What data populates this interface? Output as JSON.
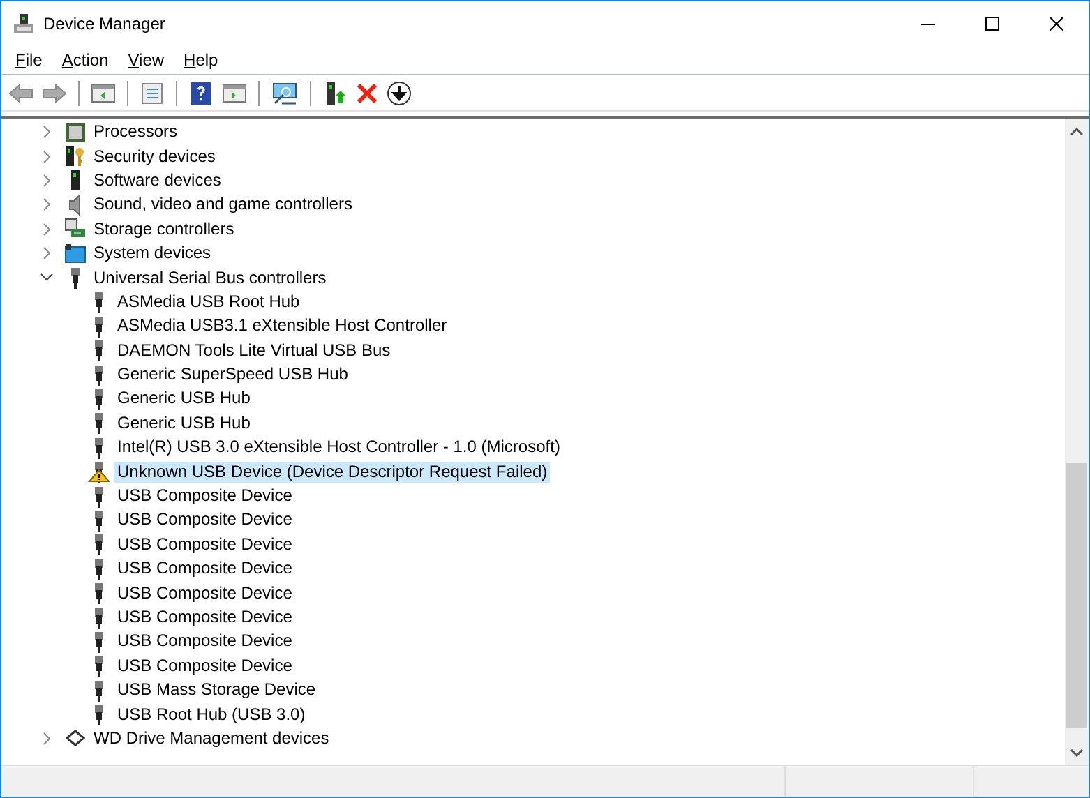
{
  "window": {
    "title": "Device Manager"
  },
  "menu": [
    "File",
    "Action",
    "View",
    "Help"
  ],
  "tree": [
    {
      "label": "Processors",
      "kind": "processor",
      "expanded": false,
      "selected": false
    },
    {
      "label": "Security devices",
      "kind": "security",
      "expanded": false,
      "selected": false
    },
    {
      "label": "Software devices",
      "kind": "software",
      "expanded": false,
      "selected": false
    },
    {
      "label": "Sound, video and game controllers",
      "kind": "sound",
      "expanded": false,
      "selected": false
    },
    {
      "label": "Storage controllers",
      "kind": "storage",
      "expanded": false,
      "selected": false
    },
    {
      "label": "System devices",
      "kind": "system",
      "expanded": false,
      "selected": false
    },
    {
      "label": "Universal Serial Bus controllers",
      "kind": "usb",
      "expanded": true,
      "selected": false,
      "children": [
        {
          "label": "ASMedia USB Root Hub",
          "kind": "usb",
          "selected": false
        },
        {
          "label": "ASMedia USB3.1 eXtensible Host Controller",
          "kind": "usb",
          "selected": false
        },
        {
          "label": "DAEMON Tools Lite Virtual USB Bus",
          "kind": "usb",
          "selected": false
        },
        {
          "label": "Generic SuperSpeed USB Hub",
          "kind": "usb",
          "selected": false
        },
        {
          "label": "Generic USB Hub",
          "kind": "usb",
          "selected": false
        },
        {
          "label": "Generic USB Hub",
          "kind": "usb",
          "selected": false
        },
        {
          "label": "Intel(R) USB 3.0 eXtensible Host Controller - 1.0 (Microsoft)",
          "kind": "usb",
          "selected": false
        },
        {
          "label": "Unknown USB Device (Device Descriptor Request Failed)",
          "kind": "warning",
          "selected": true
        },
        {
          "label": "USB Composite Device",
          "kind": "usb",
          "selected": false
        },
        {
          "label": "USB Composite Device",
          "kind": "usb",
          "selected": false
        },
        {
          "label": "USB Composite Device",
          "kind": "usb",
          "selected": false
        },
        {
          "label": "USB Composite Device",
          "kind": "usb",
          "selected": false
        },
        {
          "label": "USB Composite Device",
          "kind": "usb",
          "selected": false
        },
        {
          "label": "USB Composite Device",
          "kind": "usb",
          "selected": false
        },
        {
          "label": "USB Composite Device",
          "kind": "usb",
          "selected": false
        },
        {
          "label": "USB Composite Device",
          "kind": "usb",
          "selected": false
        },
        {
          "label": "USB Mass Storage Device",
          "kind": "usb",
          "selected": false
        },
        {
          "label": "USB Root Hub (USB 3.0)",
          "kind": "usb",
          "selected": false
        }
      ]
    },
    {
      "label": "WD Drive Management devices",
      "kind": "wd",
      "expanded": false,
      "selected": false
    }
  ]
}
